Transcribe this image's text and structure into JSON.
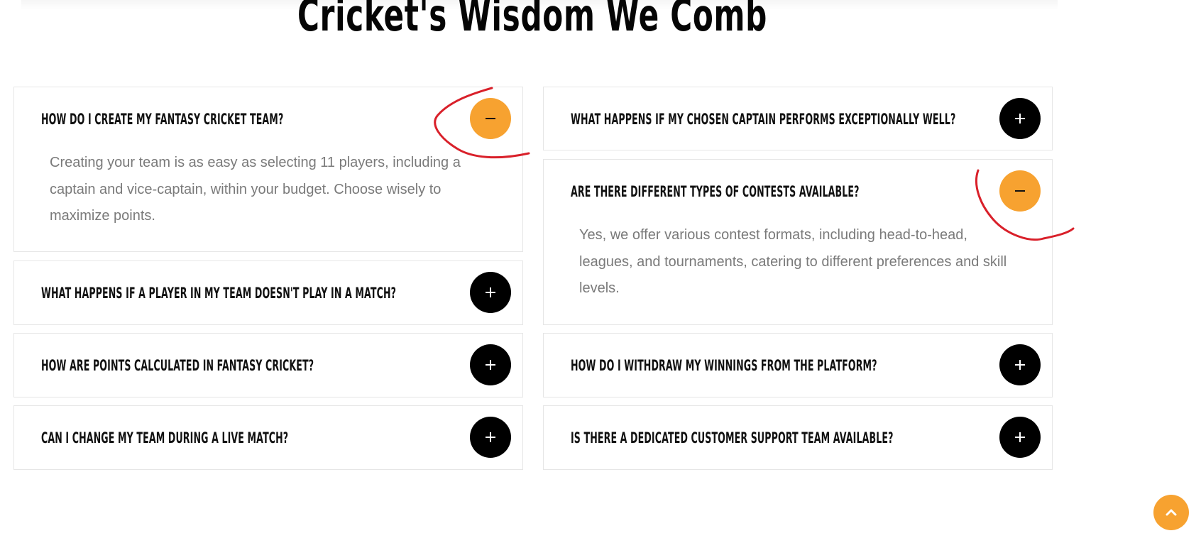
{
  "heading": "Cricket's Wisdom We Comb",
  "colors": {
    "accent": "#f7a230",
    "toggle_closed": "#000000",
    "annotation": "#d9202a"
  },
  "faq": {
    "left": [
      {
        "question": "How do I create my fantasy cricket team?",
        "state": "expanded",
        "icon": "minus-icon",
        "answer": "Creating your team is as easy as selecting 11 players, including a captain and vice-captain, within your budget. Choose wisely to maximize points."
      },
      {
        "question": "What happens if a player in my team doesn't play in a match?",
        "state": "collapsed",
        "icon": "plus-icon"
      },
      {
        "question": "How are points calculated in fantasy cricket?",
        "state": "collapsed",
        "icon": "plus-icon"
      },
      {
        "question": "Can I change my team during a live match?",
        "state": "collapsed",
        "icon": "plus-icon"
      }
    ],
    "right": [
      {
        "question": "What happens if my chosen captain performs exceptionally well?",
        "state": "collapsed",
        "icon": "plus-icon"
      },
      {
        "question": "Are there different types of contests available?",
        "state": "expanded",
        "icon": "minus-icon",
        "answer": "Yes, we offer various contest formats, including head-to-head, leagues, and tournaments, catering to different preferences and skill levels."
      },
      {
        "question": "How do I withdraw my winnings from the platform?",
        "state": "collapsed",
        "icon": "plus-icon"
      },
      {
        "question": "Is there a dedicated customer support team available?",
        "state": "collapsed",
        "icon": "plus-icon"
      }
    ]
  },
  "scroll_top": {
    "icon": "chevron-up-icon"
  }
}
